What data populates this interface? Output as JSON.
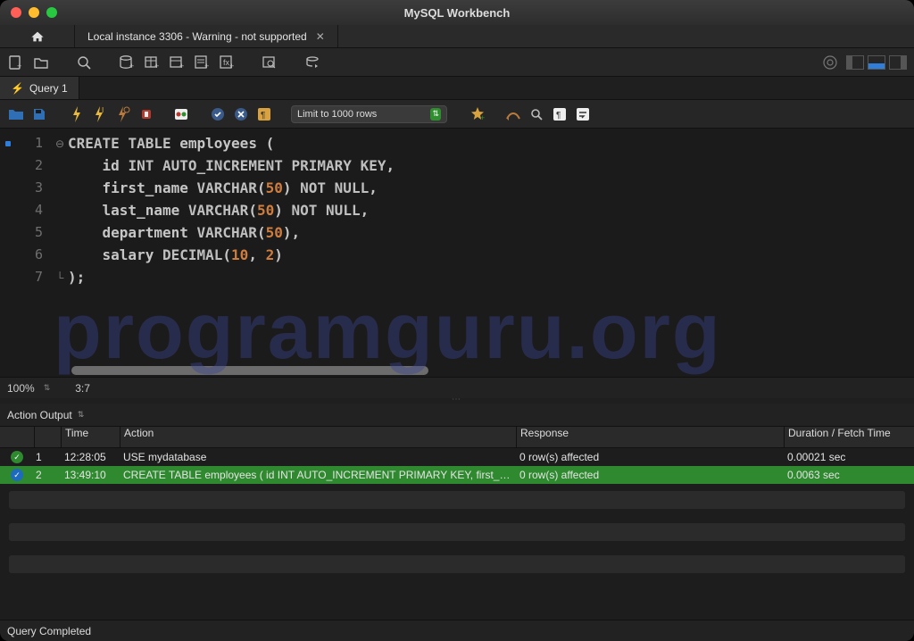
{
  "window": {
    "title": "MySQL Workbench"
  },
  "connection_tab": {
    "label": "Local instance 3306 - Warning - not supported"
  },
  "query_tab": {
    "label": "Query 1"
  },
  "limit_rows": {
    "label": "Limit to 1000 rows"
  },
  "editor": {
    "zoom": "100%",
    "cursor": "3:7",
    "lines": [
      {
        "n": "1",
        "html": "<span class='kw'>CREATE</span> <span class='kw'>TABLE</span> <span class='ident'>employees</span> <span class='punct'>(</span>"
      },
      {
        "n": "2",
        "html": "    <span class='ident'>id</span> <span class='kw'>INT</span> <span class='kw'>AUTO_INCREMENT</span> <span class='kw'>PRIMARY</span> <span class='kw'>KEY</span><span class='punct'>,</span>"
      },
      {
        "n": "3",
        "html": "    <span class='ident'>first_name</span> <span class='kw'>VARCHAR</span><span class='punct'>(</span><span class='num'>50</span><span class='punct'>)</span> <span class='kw'>NOT</span> <span class='kw'>NULL</span><span class='punct'>,</span>"
      },
      {
        "n": "4",
        "html": "    <span class='ident'>last_name</span> <span class='kw'>VARCHAR</span><span class='punct'>(</span><span class='num'>50</span><span class='punct'>)</span> <span class='kw'>NOT</span> <span class='kw'>NULL</span><span class='punct'>,</span>"
      },
      {
        "n": "5",
        "html": "    <span class='ident'>department</span> <span class='kw'>VARCHAR</span><span class='punct'>(</span><span class='num'>50</span><span class='punct'>)</span><span class='punct'>,</span>"
      },
      {
        "n": "6",
        "html": "    <span class='ident'>salary</span> <span class='kw'>DECIMAL</span><span class='punct'>(</span><span class='num'>10</span><span class='punct'>,</span> <span class='num'>2</span><span class='punct'>)</span>"
      },
      {
        "n": "7",
        "html": "<span class='punct'>);</span>"
      }
    ]
  },
  "output": {
    "selector": "Action Output",
    "headers": {
      "time": "Time",
      "action": "Action",
      "response": "Response",
      "duration": "Duration / Fetch Time"
    },
    "rows": [
      {
        "idx": "1",
        "time": "12:28:05",
        "action": "USE mydatabase",
        "response": "0 row(s) affected",
        "duration": "0.00021 sec",
        "selected": false
      },
      {
        "idx": "2",
        "time": "13:49:10",
        "action": "CREATE TABLE employees (     id INT AUTO_INCREMENT PRIMARY KEY,     first_n…",
        "response": "0 row(s) affected",
        "duration": "0.0063 sec",
        "selected": true
      }
    ]
  },
  "statusbar": {
    "text": "Query Completed"
  },
  "watermark": "programguru.org"
}
